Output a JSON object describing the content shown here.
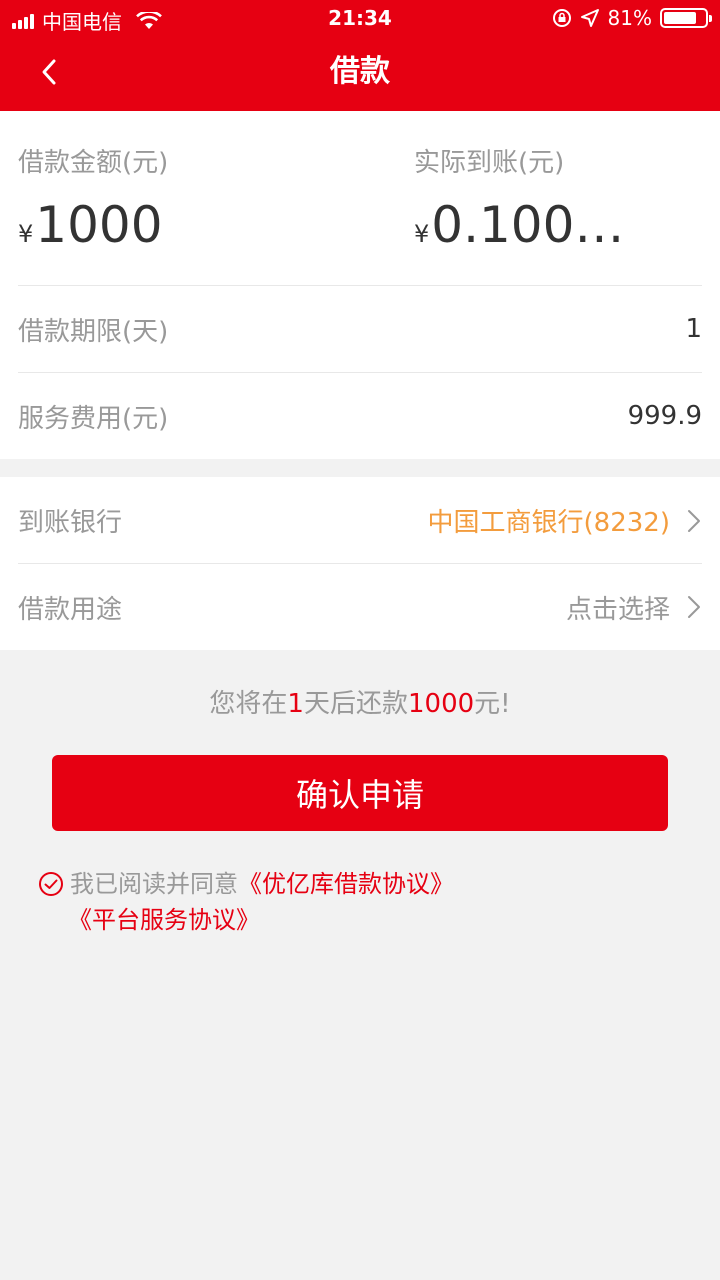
{
  "status_bar": {
    "carrier": "中国电信",
    "time": "21:34",
    "battery_text": "81%",
    "battery_level": 0.81
  },
  "header": {
    "title": "借款",
    "back_icon": "chevron-left-icon",
    "background_color": "#e60012"
  },
  "loan": {
    "amount_label": "借款金额(元)",
    "amount_currency": "¥",
    "amount_value": "1000",
    "received_label": "实际到账(元)",
    "received_currency": "¥",
    "received_value": "0.100…",
    "term_label": "借款期限(天)",
    "term_value": "1",
    "fee_label": "服务费用(元)",
    "fee_value": "999.9"
  },
  "bank": {
    "bank_label": "到账银行",
    "bank_value": "中国工商银行(8232)",
    "bank_value_color": "#f39c3d",
    "purpose_label": "借款用途",
    "purpose_value": "点击选择"
  },
  "notice": {
    "prefix": "您将在",
    "days": "1",
    "mid": "天后还款",
    "amount": "1000",
    "suffix": "元!"
  },
  "confirm_button_label": "确认申请",
  "agreement": {
    "checked": true,
    "text": "我已阅读并同意",
    "link1": "《优亿库借款协议》",
    "link2": "《平台服务协议》"
  }
}
